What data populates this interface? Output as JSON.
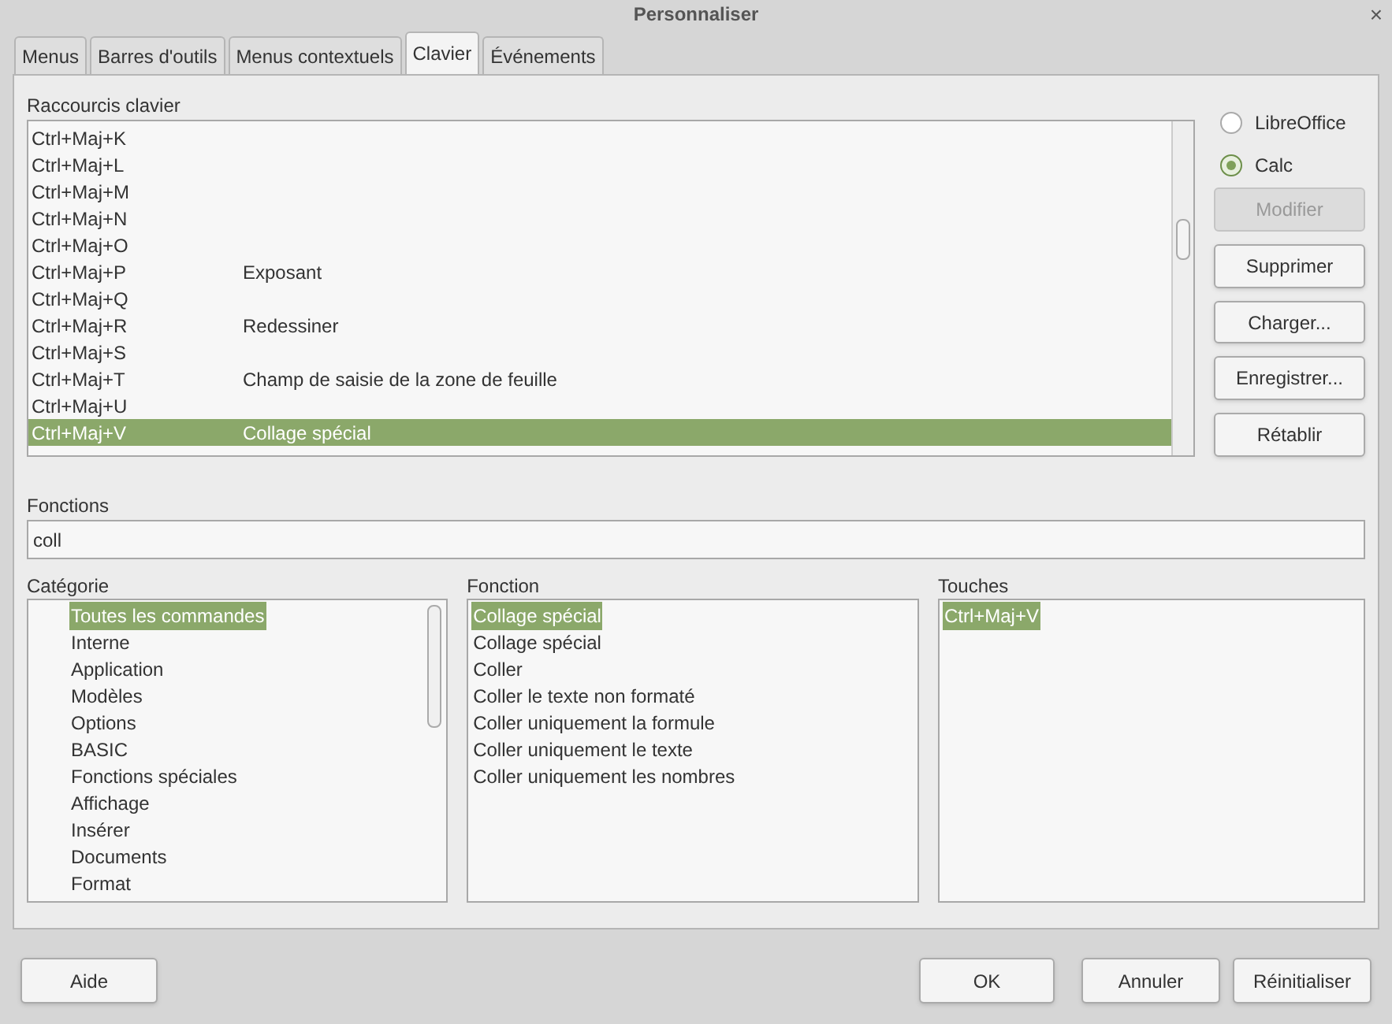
{
  "window": {
    "title": "Personnaliser",
    "close": "×"
  },
  "tabs": [
    {
      "label": "Menus",
      "selected": false
    },
    {
      "label": "Barres d'outils",
      "selected": false
    },
    {
      "label": "Menus contextuels",
      "selected": false
    },
    {
      "label": "Clavier",
      "selected": true
    },
    {
      "label": "Événements",
      "selected": false
    }
  ],
  "shortcuts": {
    "label": "Raccourcis clavier",
    "rows": [
      {
        "key": "Ctrl+Maj+K",
        "command": "",
        "selected": false
      },
      {
        "key": "Ctrl+Maj+L",
        "command": "",
        "selected": false
      },
      {
        "key": "Ctrl+Maj+M",
        "command": "",
        "selected": false
      },
      {
        "key": "Ctrl+Maj+N",
        "command": "",
        "selected": false
      },
      {
        "key": "Ctrl+Maj+O",
        "command": "",
        "selected": false
      },
      {
        "key": "Ctrl+Maj+P",
        "command": "Exposant",
        "selected": false
      },
      {
        "key": "Ctrl+Maj+Q",
        "command": "",
        "selected": false
      },
      {
        "key": "Ctrl+Maj+R",
        "command": "Redessiner",
        "selected": false
      },
      {
        "key": "Ctrl+Maj+S",
        "command": "",
        "selected": false
      },
      {
        "key": "Ctrl+Maj+T",
        "command": "Champ de saisie de la zone de feuille",
        "selected": false
      },
      {
        "key": "Ctrl+Maj+U",
        "command": "",
        "selected": false
      },
      {
        "key": "Ctrl+Maj+V",
        "command": "Collage spécial",
        "selected": true
      }
    ]
  },
  "scope": [
    {
      "label": "LibreOffice",
      "selected": false
    },
    {
      "label": "Calc",
      "selected": true
    }
  ],
  "side_buttons": [
    {
      "label": "Modifier",
      "disabled": true
    },
    {
      "label": "Supprimer",
      "disabled": false
    },
    {
      "label": "Charger...",
      "disabled": false
    },
    {
      "label": "Enregistrer...",
      "disabled": false
    },
    {
      "label": "Rétablir",
      "disabled": false
    }
  ],
  "functions": {
    "label": "Fonctions",
    "search": "coll"
  },
  "lists": [
    {
      "label": "Catégorie",
      "items": [
        {
          "text": "Toutes les commandes",
          "selected": true
        },
        {
          "text": "Interne",
          "selected": false
        },
        {
          "text": "Application",
          "selected": false
        },
        {
          "text": "Modèles",
          "selected": false
        },
        {
          "text": "Options",
          "selected": false
        },
        {
          "text": "BASIC",
          "selected": false
        },
        {
          "text": "Fonctions spéciales",
          "selected": false
        },
        {
          "text": "Affichage",
          "selected": false
        },
        {
          "text": "Insérer",
          "selected": false
        },
        {
          "text": "Documents",
          "selected": false
        },
        {
          "text": "Format",
          "selected": false
        }
      ]
    },
    {
      "label": "Fonction",
      "items": [
        {
          "text": "Collage spécial",
          "selected": true
        },
        {
          "text": "Collage spécial",
          "selected": false
        },
        {
          "text": "Coller",
          "selected": false
        },
        {
          "text": "Coller le texte non formaté",
          "selected": false
        },
        {
          "text": "Coller uniquement la formule",
          "selected": false
        },
        {
          "text": "Coller uniquement le texte",
          "selected": false
        },
        {
          "text": "Coller uniquement les nombres",
          "selected": false
        }
      ]
    },
    {
      "label": "Touches",
      "items": [
        {
          "text": "Ctrl+Maj+V",
          "selected": true
        }
      ]
    }
  ],
  "footer_buttons": [
    "Aide",
    "OK",
    "Annuler",
    "Réinitialiser"
  ]
}
